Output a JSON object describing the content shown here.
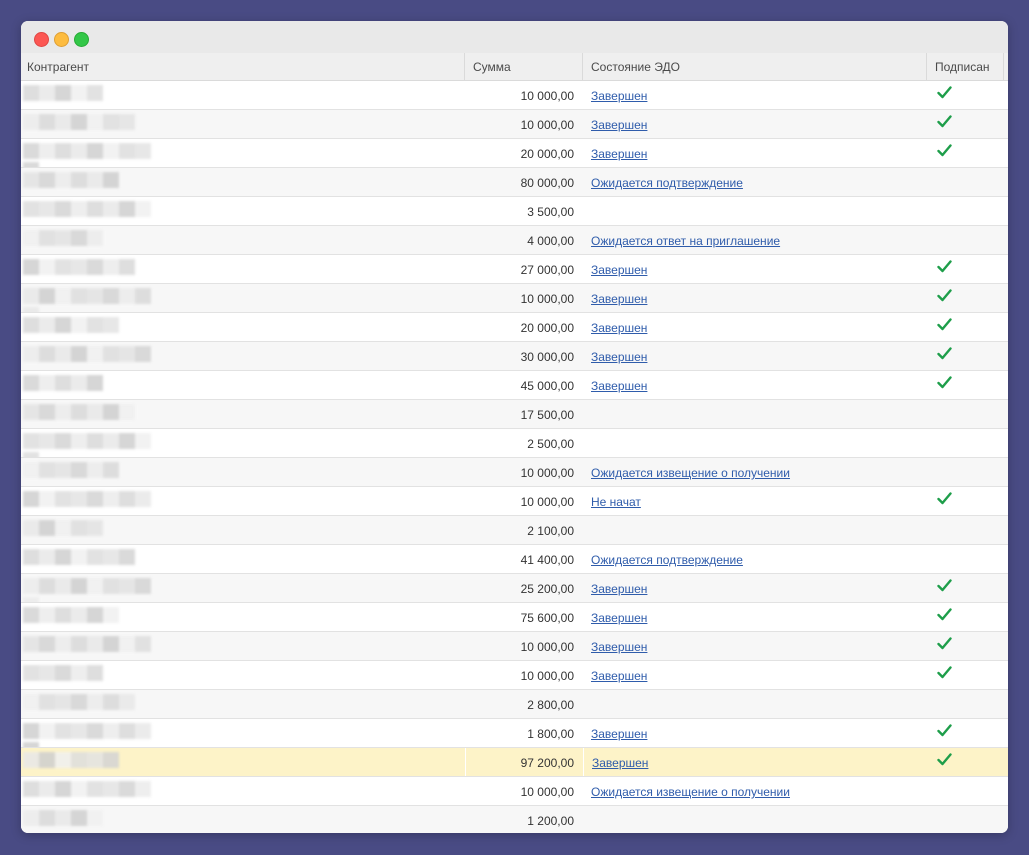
{
  "table": {
    "columns": {
      "counterparty": "Контрагент",
      "amount": "Сумма",
      "edo_status": "Состояние ЭДО",
      "signed": "Подписан"
    },
    "rows": [
      {
        "counterparty": "",
        "amount": "10 000,00",
        "status": "Завершен",
        "signed": true
      },
      {
        "counterparty": "",
        "amount": "10 000,00",
        "status": "Завершен",
        "signed": true
      },
      {
        "counterparty": "",
        "amount": "20 000,00",
        "status": "Завершен",
        "signed": true
      },
      {
        "counterparty": "",
        "amount": "80 000,00",
        "status": "Ожидается подтверждение",
        "signed": false
      },
      {
        "counterparty": "",
        "amount": "3 500,00",
        "status": "",
        "signed": false
      },
      {
        "counterparty": "",
        "amount": "4 000,00",
        "status": "Ожидается ответ на приглашение",
        "signed": false
      },
      {
        "counterparty": "",
        "amount": "27 000,00",
        "status": "Завершен",
        "signed": true
      },
      {
        "counterparty": "",
        "amount": "10 000,00",
        "status": "Завершен",
        "signed": true
      },
      {
        "counterparty": "",
        "amount": "20 000,00",
        "status": "Завершен",
        "signed": true
      },
      {
        "counterparty": "",
        "amount": "30 000,00",
        "status": "Завершен",
        "signed": true
      },
      {
        "counterparty": "",
        "amount": "45 000,00",
        "status": "Завершен",
        "signed": true
      },
      {
        "counterparty": "",
        "amount": "17 500,00",
        "status": "",
        "signed": false
      },
      {
        "counterparty": "",
        "amount": "2 500,00",
        "status": "",
        "signed": false
      },
      {
        "counterparty": "",
        "amount": "10 000,00",
        "status": "Ожидается извещение о получении",
        "signed": false
      },
      {
        "counterparty": "",
        "amount": "10 000,00",
        "status": "Не начат",
        "signed": true
      },
      {
        "counterparty": "",
        "amount": "2 100,00",
        "status": "",
        "signed": false
      },
      {
        "counterparty": "",
        "amount": "41 400,00",
        "status": "Ожидается подтверждение",
        "signed": false
      },
      {
        "counterparty": "",
        "amount": "25 200,00",
        "status": "Завершен",
        "signed": true
      },
      {
        "counterparty": "",
        "amount": "75 600,00",
        "status": "Завершен",
        "signed": true
      },
      {
        "counterparty": "",
        "amount": "10 000,00",
        "status": "Завершен",
        "signed": true
      },
      {
        "counterparty": "",
        "amount": "10 000,00",
        "status": "Завершен",
        "signed": true
      },
      {
        "counterparty": "",
        "amount": "2 800,00",
        "status": "",
        "signed": false
      },
      {
        "counterparty": "",
        "amount": "1 800,00",
        "status": "Завершен",
        "signed": true
      },
      {
        "counterparty": "",
        "amount": "97 200,00",
        "status": "Завершен",
        "signed": true,
        "selected": true
      },
      {
        "counterparty": "",
        "amount": "10 000,00",
        "status": "Ожидается извещение о получении",
        "signed": false
      },
      {
        "counterparty": "",
        "amount": "1 200,00",
        "status": "",
        "signed": false
      }
    ]
  },
  "colors": {
    "background": "#494b84",
    "link": "#2f5cab",
    "check": "#1e9e4a",
    "selected_row": "#fdf3c8"
  },
  "icons": {
    "signed": "checkmark-icon"
  }
}
